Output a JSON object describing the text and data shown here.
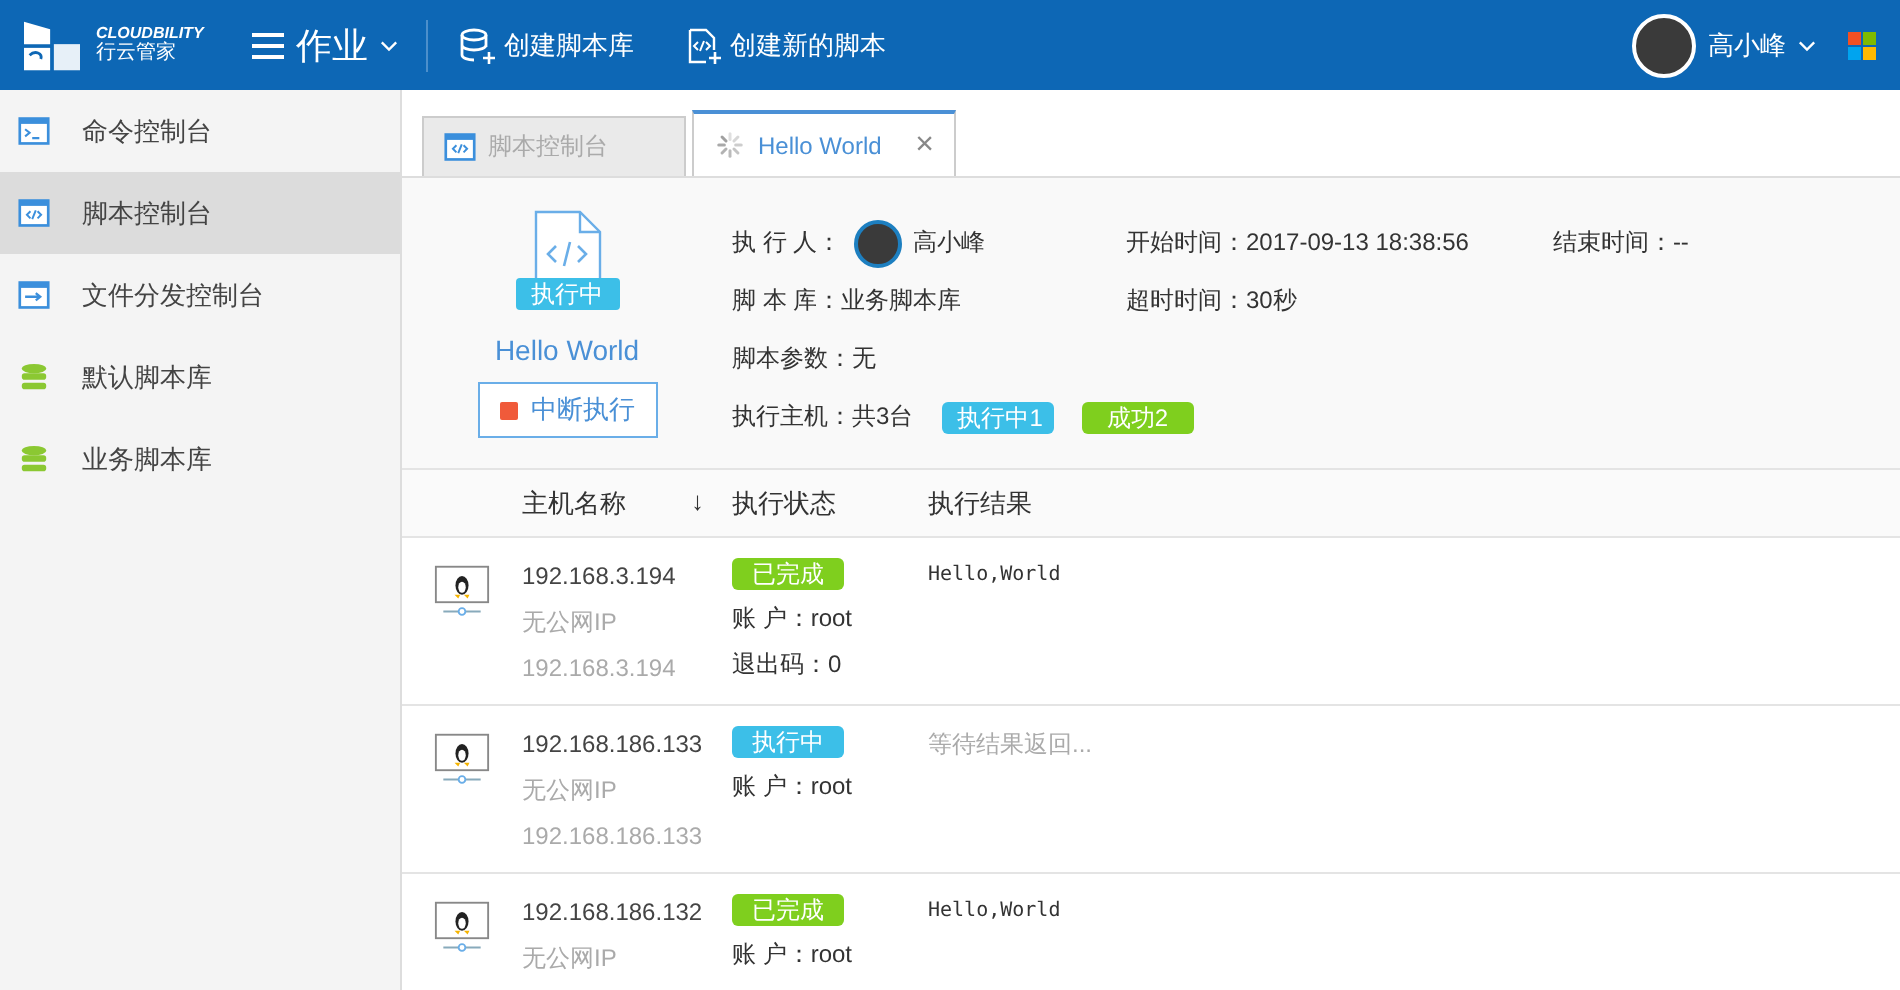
{
  "header": {
    "logo_text": "CLOUDBILITY",
    "logo_subtext": "行云管家",
    "menu_title": "作业",
    "actions": [
      {
        "label": "创建脚本库",
        "kind": "database"
      },
      {
        "label": "创建新的脚本",
        "kind": "script"
      }
    ],
    "user": {
      "name": "高小峰"
    }
  },
  "sidebar": {
    "items": [
      {
        "label": "命令控制台",
        "kind": "terminal",
        "selected": false
      },
      {
        "label": "脚本控制台",
        "kind": "script",
        "selected": true
      },
      {
        "label": "文件分发控制台",
        "kind": "transfer",
        "selected": false
      },
      {
        "label": "默认脚本库",
        "kind": "database",
        "selected": false
      },
      {
        "label": "业务脚本库",
        "kind": "database",
        "selected": false
      }
    ]
  },
  "tabs": [
    {
      "label": "脚本控制台",
      "kind": "script",
      "selected": false
    },
    {
      "label": "Hello World",
      "kind": "loading",
      "selected": true,
      "close_icon": "×"
    }
  ],
  "job": {
    "status_badge": "执行中",
    "name": "Hello World",
    "stop_button": "中断执行",
    "executor": {
      "label": "执 行 人：",
      "value": "高小峰"
    },
    "library": "脚 本 库：业务脚本库",
    "params": "脚本参数：无",
    "hosts": "执行主机：共3台",
    "host_badges": [
      {
        "label": "执行中1",
        "kind": "running"
      },
      {
        "label": "成功2",
        "kind": "done"
      }
    ],
    "start_time": "开始时间：2017-09-13 18:38:56",
    "end_time": "结束时间：--",
    "timeout": "超时时间：30秒"
  },
  "table": {
    "columns": [
      {
        "label": "主机名称",
        "sort_arrow": "↓"
      },
      {
        "label": "执行状态"
      },
      {
        "label": "执行结果"
      }
    ],
    "rows": [
      {
        "host": "192.168.3.194",
        "public_ip": "无公网IP",
        "private_ip": "192.168.3.194",
        "status": {
          "label": "已完成",
          "kind": "done"
        },
        "account": "账 户：root",
        "exit_code": "退出码：0",
        "result": {
          "text": "Hello,World",
          "kind": "output"
        }
      },
      {
        "host": "192.168.186.133",
        "public_ip": "无公网IP",
        "private_ip": "192.168.186.133",
        "status": {
          "label": "执行中",
          "kind": "running"
        },
        "account": "账 户：root",
        "result": {
          "text": "等待结果返回...",
          "kind": "pending"
        }
      },
      {
        "host": "192.168.186.132",
        "public_ip": "无公网IP",
        "status": {
          "label": "已完成",
          "kind": "done"
        },
        "account": "账 户：root",
        "result": {
          "text": "Hello,World",
          "kind": "output"
        }
      }
    ]
  }
}
